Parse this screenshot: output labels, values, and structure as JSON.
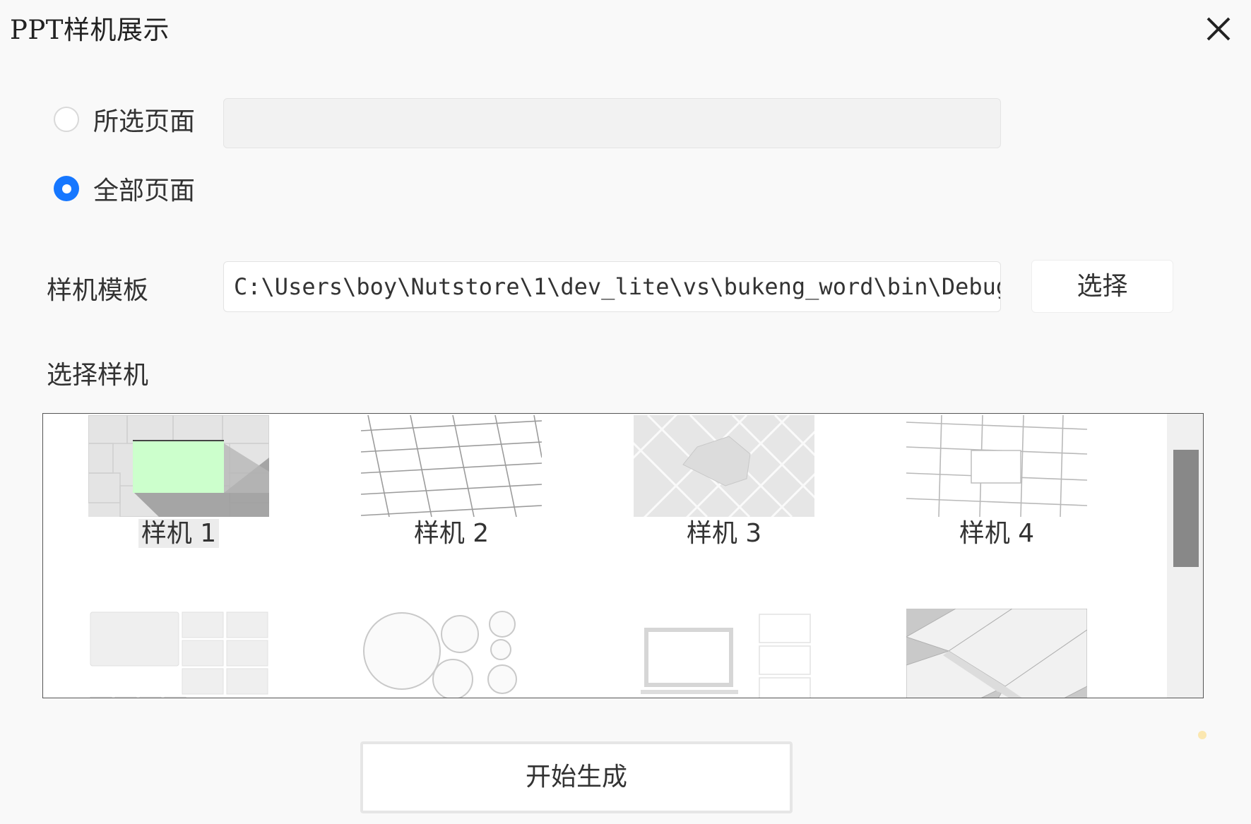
{
  "window": {
    "title": "PPT样机展示",
    "close_icon": "close-icon"
  },
  "page_range": {
    "options": [
      {
        "label": "所选页面",
        "checked": false
      },
      {
        "label": "全部页面",
        "checked": true
      }
    ],
    "selected_pages_value": ""
  },
  "template": {
    "label": "样机模板",
    "path_value": "C:\\Users\\boy\\Nutstore\\1\\dev_lite\\vs\\bukeng_word\\bin\\Debug\\不",
    "choose_button": "选择"
  },
  "mockups": {
    "label": "选择样机",
    "items": [
      {
        "label": "样机 1",
        "selected": true
      },
      {
        "label": "样机 2",
        "selected": false
      },
      {
        "label": "样机 3",
        "selected": false
      },
      {
        "label": "样机 4",
        "selected": false
      },
      {
        "label": "",
        "selected": false
      },
      {
        "label": "",
        "selected": false
      },
      {
        "label": "",
        "selected": false
      },
      {
        "label": "",
        "selected": false
      }
    ]
  },
  "start_button": "开始生成",
  "colors": {
    "accent": "#1677ff",
    "highlight_slide": "#ccffcc"
  }
}
